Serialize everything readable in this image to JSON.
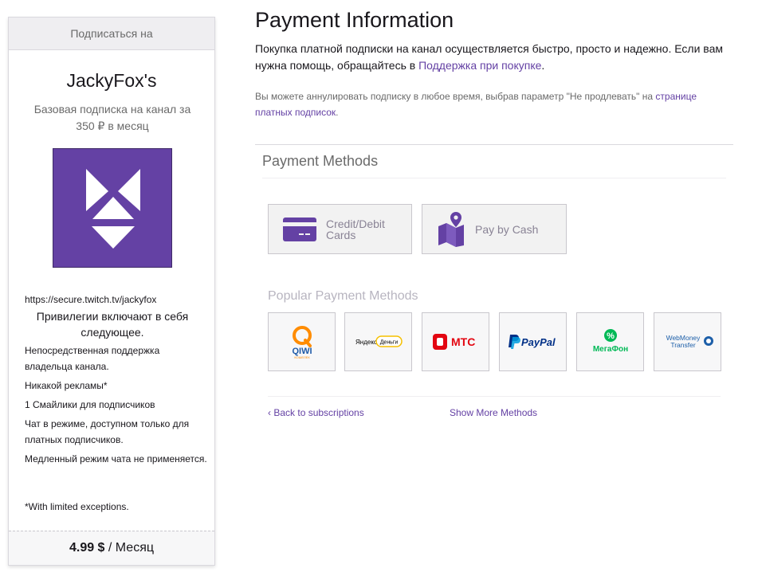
{
  "card": {
    "header": "Подписаться на",
    "channel_name": "JackyFox's",
    "subscription_desc": "Базовая подписка на канал за 350 ₽ в месяц",
    "channel_url": "https://secure.twitch.tv/jackyfox",
    "perks_title": "Привилегии включают в себя следующее.",
    "perks": [
      "Непосредственная поддержка владельца канала.",
      "Никакой рекламы*",
      "1 Смайлики для подписчиков",
      "Чат в режиме, доступном только для платных подписчиков.",
      "Медленный режим чата не применяется."
    ],
    "exceptions": "*With limited exceptions.",
    "price_amount": "4.99 $",
    "price_period": " / Месяц",
    "logo_color": "#6441a4"
  },
  "main": {
    "title": "Payment Information",
    "intro_text": "Покупка платной подписки на канал осуществляется быстро, просто и надежно. Если вам нужна помощь, обращайтесь в ",
    "intro_link": "Поддержка при покупке",
    "intro_end": ".",
    "cancel_text": "Вы можете аннулировать подписку в любое время, выбрав параметр \"Не продлевать\" на ",
    "cancel_link": "странице платных подписок",
    "cancel_end": ".",
    "payment_methods_title": "Payment Methods",
    "methods": [
      {
        "label": "Credit/Debit Cards",
        "icon": "credit-card-icon"
      },
      {
        "label": "Pay by Cash",
        "icon": "map-pin-icon"
      }
    ],
    "popular_title": "Popular Payment Methods",
    "popular": [
      {
        "name": "QIWI",
        "sub": "КОШЕЛЕК"
      },
      {
        "name": "Яндекс",
        "sub": "Деньги"
      },
      {
        "name": "МТС"
      },
      {
        "name": "PayPal"
      },
      {
        "name": "МегаФон"
      },
      {
        "name": "WebMoney",
        "sub": "Transfer"
      }
    ],
    "back_link": "Back to subscriptions",
    "more_link": "Show More Methods",
    "accent_color": "#6441a4"
  }
}
